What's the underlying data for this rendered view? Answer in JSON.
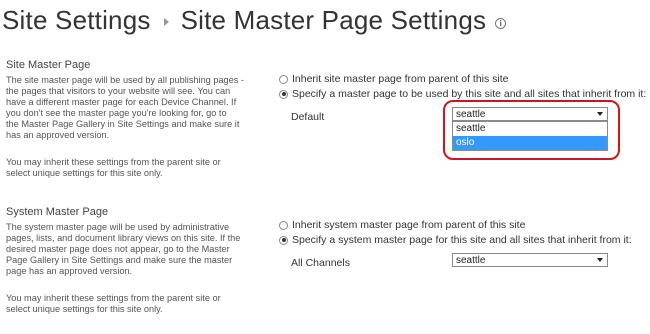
{
  "header": {
    "title": "Site Settings",
    "subtitle": "Site Master Page Settings",
    "info_icon": "info-icon"
  },
  "site_master": {
    "heading": "Site Master Page",
    "description_lines": [
      "The site master page will be used by all publishing pages -",
      "the pages that visitors to your website will see. You can",
      "have a different master page for each Device Channel. If",
      "you don't see the master page you're looking for, go to",
      "the Master Page Gallery in Site Settings and make sure it",
      "has an approved version."
    ],
    "inherit_lines": [
      "You may inherit these settings from the parent site or",
      "select unique settings for this site only."
    ],
    "option_inherit": "Inherit site master page from parent of this site",
    "option_specify": "Specify a master page to be used by this site and all sites that inherit from it:",
    "selected_option": "specify",
    "field_label": "Default",
    "select_value": "seattle",
    "dropdown_open": true,
    "dropdown_options": [
      "seattle",
      "oslo"
    ],
    "highlighted_option": "oslo"
  },
  "system_master": {
    "heading": "System Master Page",
    "description_lines": [
      "The system master page will be used by administrative",
      "pages, lists, and document library views on this site. If the",
      "desired master page does not appear, go to the Master",
      "Page Gallery in Site Settings and make sure the master",
      "page has an approved version."
    ],
    "inherit_lines": [
      "You may inherit these settings from the parent site or",
      "select unique settings for this site only."
    ],
    "option_inherit": "Inherit system master page from parent of this site",
    "option_specify": "Specify a system master page for this site and all sites that inherit from it:",
    "selected_option": "specify",
    "field_label": "All Channels",
    "select_value": "seattle"
  },
  "colors": {
    "annotation": "#d0141b",
    "highlight": "#3399ff"
  }
}
